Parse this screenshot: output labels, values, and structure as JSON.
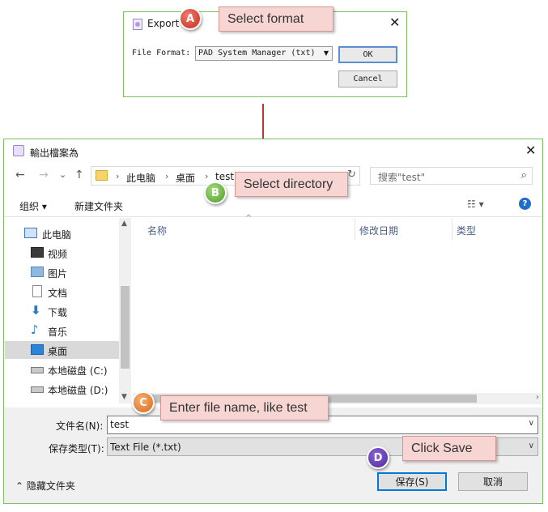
{
  "export_dialog": {
    "title": "Export",
    "close_glyph": "✕",
    "file_format_label": "File Format:",
    "file_format_value": "PAD System Manager (txt)",
    "ok_label": "OK",
    "cancel_label": "Cancel"
  },
  "save_dialog": {
    "title": "輸出檔案為",
    "close_glyph": "✕",
    "nav": {
      "back": "←",
      "forward": "→",
      "up_menu": "⌄",
      "up": "↑"
    },
    "breadcrumb": [
      "此电脑",
      "桌面",
      "test"
    ],
    "search_placeholder": "搜索\"test\"",
    "toolbar": {
      "organize": "组织 ▾",
      "new_folder": "新建文件夹"
    },
    "sidebar": [
      {
        "label": "此电脑",
        "icon": "computer-icon"
      },
      {
        "label": "视频",
        "icon": "video-icon"
      },
      {
        "label": "图片",
        "icon": "pictures-icon"
      },
      {
        "label": "文档",
        "icon": "document-icon"
      },
      {
        "label": "下载",
        "icon": "download-icon"
      },
      {
        "label": "音乐",
        "icon": "music-icon"
      },
      {
        "label": "桌面",
        "icon": "desktop-icon",
        "selected": true
      },
      {
        "label": "本地磁盘 (C:)",
        "icon": "drive-icon"
      },
      {
        "label": "本地磁盘 (D:)",
        "icon": "drive-icon"
      }
    ],
    "columns": [
      "名称",
      "修改日期",
      "类型"
    ],
    "filename_label": "文件名(N):",
    "filename_value": "test",
    "filetype_label": "保存类型(T):",
    "filetype_value": "Text File (*.txt)",
    "hide_folders": "隐藏文件夹",
    "save_label": "保存(S)",
    "cancel_label": "取消"
  },
  "callouts": {
    "a": {
      "badge": "A",
      "text": "Select format"
    },
    "b": {
      "badge": "B",
      "text": "Select directory"
    },
    "c": {
      "badge": "C",
      "text": "Enter file name, like test"
    },
    "d": {
      "badge": "D",
      "text": "Click Save"
    }
  },
  "colors": {
    "frame_green": "#7fbf64",
    "arrow": "#b5393b",
    "callout_fill": "#f6d5d2",
    "accent_blue": "#0078d7"
  }
}
